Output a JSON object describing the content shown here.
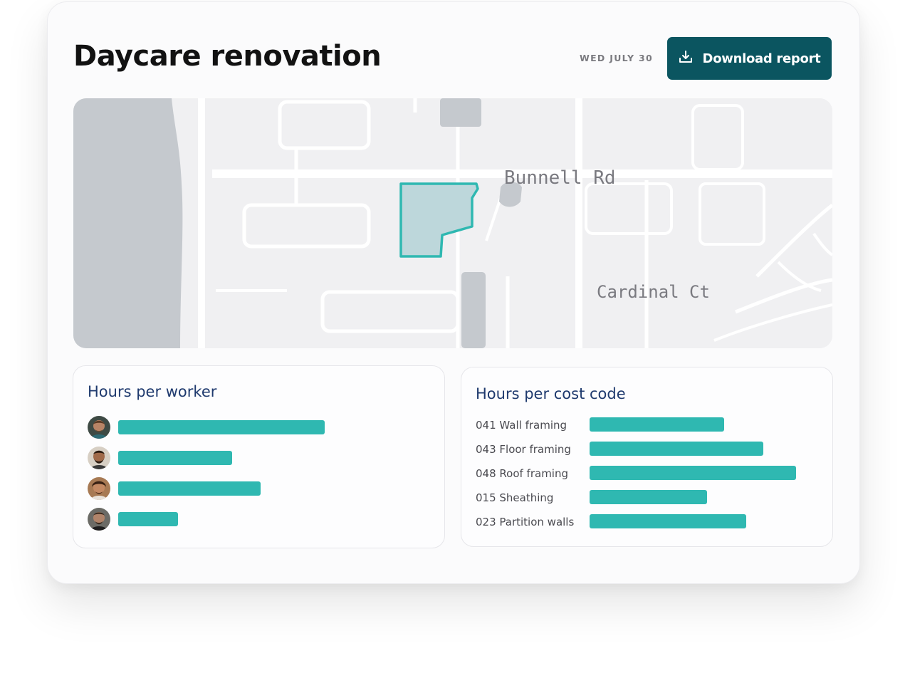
{
  "header": {
    "title": "Daycare renovation",
    "date": "WED JULY 30",
    "download_label": "Download report"
  },
  "map": {
    "streets": [
      "Bunnell Rd",
      "Cardinal Ct"
    ],
    "site_fill": "#bdd7db",
    "site_stroke": "#2fb8b1"
  },
  "workers_panel": {
    "title": "Hours per worker",
    "max_value": 100,
    "workers": [
      {
        "value": 100
      },
      {
        "value": 55
      },
      {
        "value": 69
      },
      {
        "value": 29
      }
    ]
  },
  "cost_panel": {
    "title": "Hours per cost code",
    "max_value": 100,
    "codes": [
      {
        "label": "041 Wall framing",
        "value": 65
      },
      {
        "label": "043 Floor framing",
        "value": 84
      },
      {
        "label": "048 Roof framing",
        "value": 100
      },
      {
        "label": "015 Sheathing",
        "value": 57
      },
      {
        "label": "023 Partition walls",
        "value": 76
      }
    ]
  },
  "colors": {
    "accent": "#0b5560",
    "bar": "#2fb8b1",
    "panel_title": "#1f3a6e"
  }
}
